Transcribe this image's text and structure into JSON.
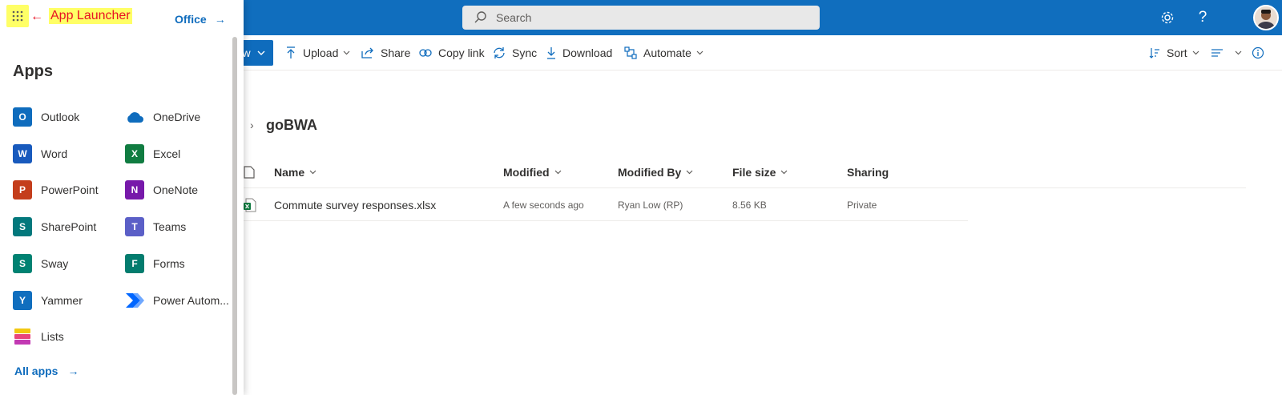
{
  "colors": {
    "suite_blue": "#106ebe",
    "link_blue": "#0f6cbd",
    "highlight_yellow": "#ffff66",
    "annotation_red": "#e81123"
  },
  "suitebar": {
    "search_placeholder": "Search",
    "icons": [
      "settings-icon",
      "help-icon",
      "avatar"
    ],
    "help_glyph": "?"
  },
  "commandbar": {
    "new_partial": "w",
    "upload": "Upload",
    "share": "Share",
    "copy_link": "Copy link",
    "sync": "Sync",
    "download": "Download",
    "automate": "Automate",
    "sort": "Sort"
  },
  "breadcrumb": {
    "separator": "›",
    "current": "goBWA"
  },
  "table": {
    "headers": {
      "name": "Name",
      "modified": "Modified",
      "modified_by": "Modified By",
      "file_size": "File size",
      "sharing": "Sharing"
    },
    "rows": [
      {
        "name": "Commute survey responses.xlsx",
        "modified": "A few seconds ago",
        "modified_by": "Ryan Low (RP)",
        "file_size": "8.56 KB",
        "sharing": "Private"
      }
    ]
  },
  "launcher": {
    "annotation_arrow": "←",
    "annotation_label": "App Launcher",
    "office_link": "Office",
    "link_arrow": "→",
    "apps_title": "Apps",
    "apps_left": [
      {
        "label": "Outlook",
        "icon": "outlook-icon",
        "letter": "O",
        "color": "#0f6cbd"
      },
      {
        "label": "Word",
        "icon": "word-icon",
        "letter": "W",
        "color": "#185abd"
      },
      {
        "label": "PowerPoint",
        "icon": "powerpoint-icon",
        "letter": "P",
        "color": "#c43e1c"
      },
      {
        "label": "SharePoint",
        "icon": "sharepoint-icon",
        "letter": "S",
        "color": "#03787c"
      },
      {
        "label": "Sway",
        "icon": "sway-icon",
        "letter": "S",
        "color": "#008272"
      },
      {
        "label": "Yammer",
        "icon": "yammer-icon",
        "letter": "Y",
        "color": "#106ebe"
      },
      {
        "label": "Lists",
        "icon": "lists-icon",
        "letter": "",
        "color": "#c239b3"
      }
    ],
    "apps_right": [
      {
        "label": "OneDrive",
        "icon": "onedrive-icon",
        "letter": "",
        "color": "#0f6cbd"
      },
      {
        "label": "Excel",
        "icon": "excel-icon",
        "letter": "X",
        "color": "#107c41"
      },
      {
        "label": "OneNote",
        "icon": "onenote-icon",
        "letter": "N",
        "color": "#7719aa"
      },
      {
        "label": "Teams",
        "icon": "teams-icon",
        "letter": "T",
        "color": "#5b5fc7"
      },
      {
        "label": "Forms",
        "icon": "forms-icon",
        "letter": "F",
        "color": "#037c6e"
      },
      {
        "label": "Power Autom...",
        "icon": "power-automate-icon",
        "letter": "",
        "color": "#0066ff"
      }
    ],
    "all_apps": "All apps"
  }
}
